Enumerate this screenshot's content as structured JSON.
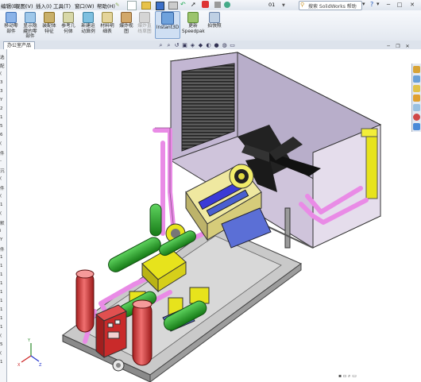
{
  "menu": {
    "items": [
      {
        "label": "编辑(E)"
      },
      {
        "label": "视图(V)"
      },
      {
        "label": "插入(I)"
      },
      {
        "label": "工具(T)"
      },
      {
        "label": "窗口(W)"
      },
      {
        "label": "帮助(H)"
      }
    ],
    "doc_name": "01",
    "search_placeholder": "搜索 SolidWorks 帮助",
    "win_controls": [
      "─",
      "□",
      "✕"
    ]
  },
  "toolbar": {
    "buttons": [
      {
        "label": "移动零\n部件",
        "name": "move-component"
      },
      {
        "label": "显示隐\n藏的零\n部件",
        "name": "show-hidden-components"
      },
      {
        "label": "装配体\n特征",
        "name": "assembly-features"
      },
      {
        "label": "参考几\n何体",
        "name": "reference-geometry"
      },
      {
        "label": "新建运\n动算例",
        "name": "new-motion-study"
      },
      {
        "label": "材料明\n细表",
        "name": "bill-of-materials"
      },
      {
        "label": "爆炸视\n图",
        "name": "exploded-view"
      },
      {
        "label": "爆炸直\n线草图",
        "name": "explode-line-sketch"
      },
      {
        "label": "Instant3D",
        "name": "instant3d"
      },
      {
        "label": "更新\nSpeedpak",
        "name": "update-speedpak"
      },
      {
        "label": "拍快照",
        "name": "take-snapshot"
      }
    ]
  },
  "tabs": {
    "active": "办公室产品"
  },
  "leftpanel": {
    "fragments": [
      "选",
      "配",
      "(",
      "3",
      "3",
      "Y",
      "2",
      "1",
      "5",
      "6",
      "(",
      "件",
      "-",
      "沉",
      "(",
      "件",
      "(",
      "1",
      "(",
      "默",
      "i",
      "Y",
      "件",
      "1",
      "1",
      "1",
      "1",
      "1",
      "1",
      "1",
      "1",
      "1",
      "(",
      "5",
      "(",
      "1"
    ]
  },
  "colors": {
    "pipe": "#e98be6",
    "green": "#1f9f1f",
    "yellow": "#e7e31c",
    "red_vessel": "#d63a3a",
    "frame": "#a5a5a5",
    "blue": "#4a5fd0",
    "housing": "#d8cde2",
    "cabinet": "#c92a2a"
  }
}
